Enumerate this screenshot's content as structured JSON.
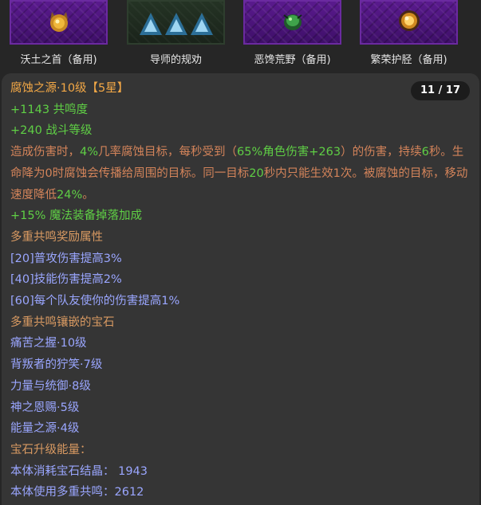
{
  "slots": [
    {
      "label": "沃土之首（备用)",
      "icon": "golden-head-icon"
    },
    {
      "label": "导师的规劝",
      "icon": "triangle-gems-icon"
    },
    {
      "label": "恶馋荒野（备用)",
      "icon": "green-beetle-icon"
    },
    {
      "label": "繁荣护胫（备用)",
      "icon": "golden-orb-icon"
    }
  ],
  "panel": {
    "title": "腐蚀之源·10级【5星】",
    "page": "11 / 17",
    "resonance": "+1143 共鸣度",
    "combat_level": "+240 战斗等级",
    "desc": {
      "p1": "造成伤害时，",
      "v1": "4%",
      "p2": "几率腐蚀目标，每秒受到（",
      "v2": "65%角色伤害+263",
      "p3": "）的伤害，持续",
      "v3": "6",
      "p4": "秒。生命降为0时腐蚀会传播给周围的目标。同一目标",
      "v4": "20",
      "p5": "秒内只能生效1次。被腐蚀的目标，移动速度降低",
      "v5": "24%",
      "p6": "。"
    },
    "magic_drop": "+15% 魔法装备掉落加成",
    "bonus_header": "多重共鸣奖励属性",
    "bonus": [
      "[20]普攻伤害提高3%",
      "[40]技能伤害提高2%",
      "[60]每个队友使你的伤害提高1%"
    ],
    "gems_header": "多重共鸣镶嵌的宝石",
    "gems": [
      "痛苦之握·10级",
      "背叛者的狞笑·7级",
      "力量与统御·8级",
      "神之恩赐·5级",
      "能量之源·4级"
    ],
    "upgrade_header": "宝石升级能量：",
    "cost1": "本体消耗宝石结晶： 1943",
    "cost2": "本体使用多重共鸣：2612"
  }
}
